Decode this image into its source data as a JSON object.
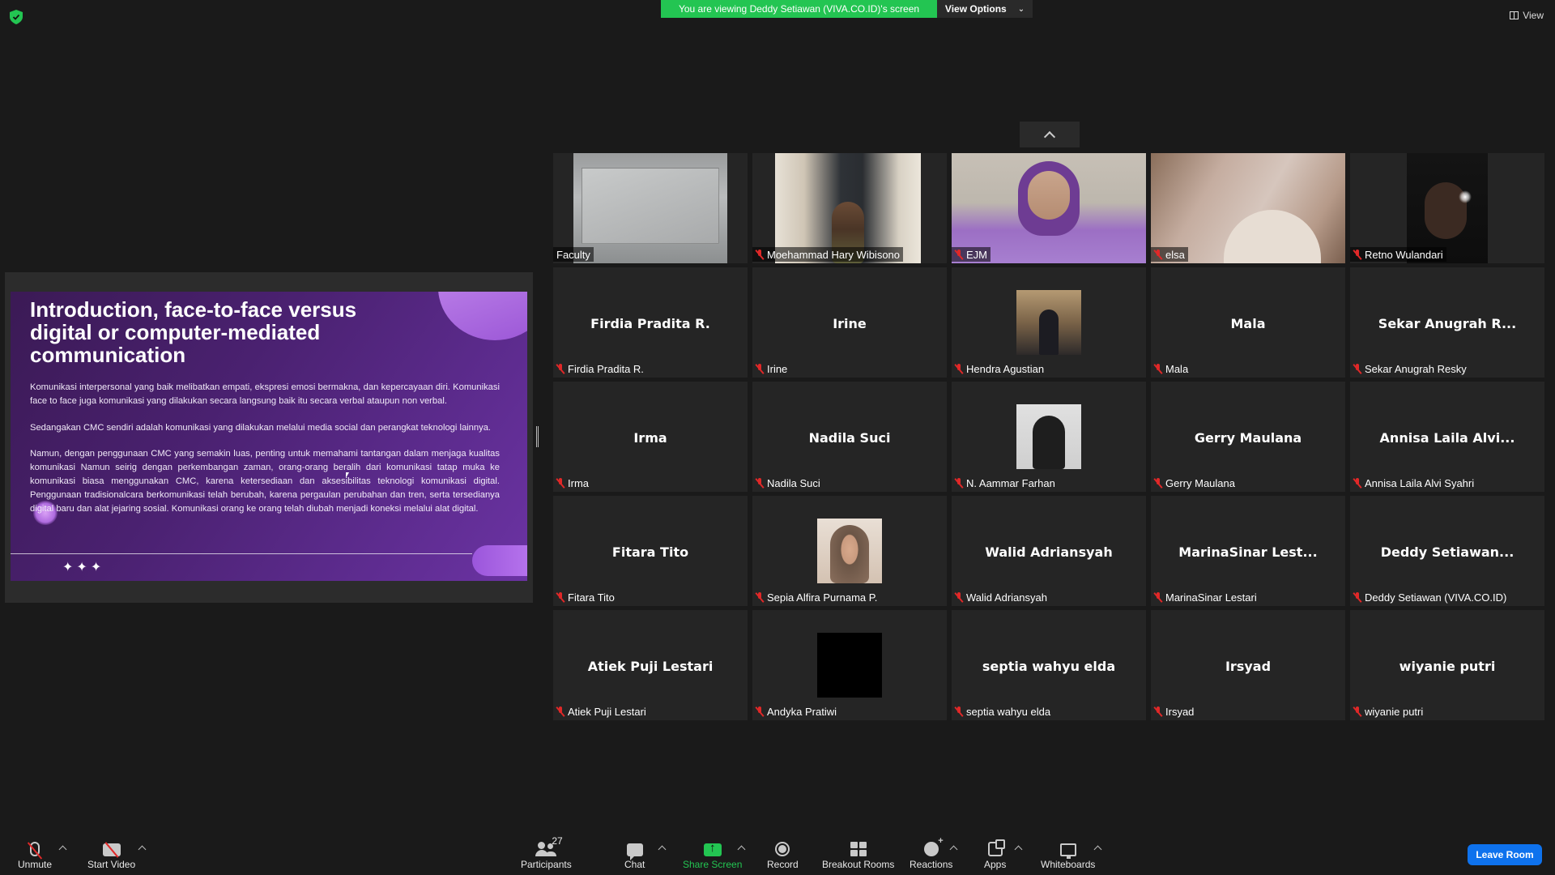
{
  "top": {
    "share_banner": "You are viewing Deddy Setiawan (VIVA.CO.ID)'s screen",
    "view_options": "View Options",
    "view": "View"
  },
  "slide": {
    "title": "Introduction, face-to-face versus digital or computer-mediated communication",
    "paragraphs": [
      "Komunikasi interpersonal yang baik melibatkan empati, ekspresi emosi bermakna, dan kepercayaan diri. Komunikasi face to face juga komunikasi yang dilakukan secara langsung baik itu secara verbal ataupun non verbal.",
      "Sedangakan CMC sendiri adalah komunikasi yang dilakukan melalui media social dan perangkat teknologi lainnya.",
      "Namun, dengan penggunaan CMC yang semakin luas, penting untuk memahami tantangan dalam menjaga kualitas komunikasi Namun seirig dengan perkembangan zaman, orang-orang beralih dari komunikasi tatap muka ke komunikasi biasa menggunakan CMC, karena ketersediaan dan aksesibilitas teknologi komunikasi digital. Penggunaan tradisionalcara berkomunikasi telah berubah, karena pergaulan perubahan dan tren, serta tersedianya digital baru dan alat jejaring sosial. Komunikasi orang ke orang telah diubah menjadi koneksi melalui alat digital."
    ],
    "stars": "✦✦✦"
  },
  "participants": [
    {
      "label": "Faculty",
      "center": "",
      "muted": false
    },
    {
      "label": "Moehammad Hary Wibisono",
      "center": "",
      "muted": true
    },
    {
      "label": "EJM",
      "center": "",
      "muted": true
    },
    {
      "label": "elsa",
      "center": "",
      "muted": true
    },
    {
      "label": "Retno Wulandari",
      "center": "",
      "muted": true
    },
    {
      "label": "Firdia Pradita R.",
      "center": "Firdia Pradita R.",
      "muted": true
    },
    {
      "label": "Irine",
      "center": "Irine",
      "muted": true
    },
    {
      "label": "Hendra Agustian",
      "center": "",
      "muted": true
    },
    {
      "label": "Mala",
      "center": "Mala",
      "muted": true
    },
    {
      "label": "Sekar Anugrah Resky",
      "center": "Sekar Anugrah R...",
      "muted": true
    },
    {
      "label": "Irma",
      "center": "Irma",
      "muted": true
    },
    {
      "label": "Nadila Suci",
      "center": "Nadila Suci",
      "muted": true
    },
    {
      "label": "N. Aammar Farhan",
      "center": "",
      "muted": true
    },
    {
      "label": "Gerry Maulana",
      "center": "Gerry Maulana",
      "muted": true
    },
    {
      "label": "Annisa Laila Alvi Syahri",
      "center": "Annisa Laila Alvi...",
      "muted": true
    },
    {
      "label": "Fitara Tito",
      "center": "Fitara Tito",
      "muted": true
    },
    {
      "label": "Sepia Alfira Purnama P.",
      "center": "",
      "muted": true
    },
    {
      "label": "Walid Adriansyah",
      "center": "Walid Adriansyah",
      "muted": true
    },
    {
      "label": "MarinaSinar Lestari",
      "center": "MarinaSinar Lest...",
      "muted": true
    },
    {
      "label": "Deddy Setiawan (VIVA.CO.ID)",
      "center": "Deddy Setiawan...",
      "muted": true
    },
    {
      "label": "Atiek Puji Lestari",
      "center": "Atiek Puji Lestari",
      "muted": true
    },
    {
      "label": "Andyka Pratiwi",
      "center": "",
      "muted": true
    },
    {
      "label": "septia wahyu elda",
      "center": "septia wahyu elda",
      "muted": true
    },
    {
      "label": "Irsyad",
      "center": "Irsyad",
      "muted": true
    },
    {
      "label": "wiyanie putri",
      "center": "wiyanie putri",
      "muted": true
    }
  ],
  "toolbar": {
    "unmute": "Unmute",
    "start_video": "Start Video",
    "participants": "Participants",
    "participant_count": "27",
    "chat": "Chat",
    "share_screen": "Share Screen",
    "record": "Record",
    "breakout_rooms": "Breakout Rooms",
    "reactions": "Reactions",
    "apps": "Apps",
    "whiteboards": "Whiteboards",
    "leave_room": "Leave Room"
  },
  "colors": {
    "share_green": "#23c552",
    "leave_blue": "#0e72ed",
    "muted_red": "#e02828"
  }
}
